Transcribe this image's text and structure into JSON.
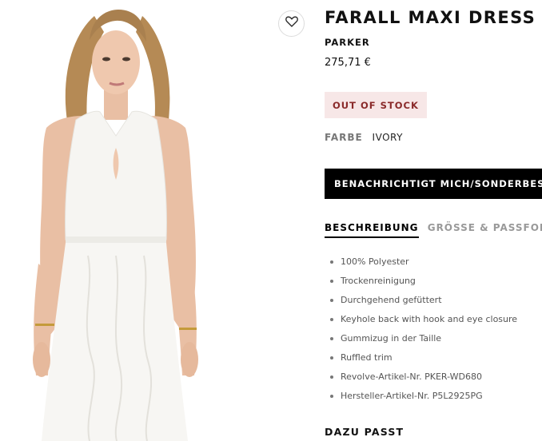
{
  "product": {
    "title": "FARALL MAXI DRESS",
    "brand": "PARKER",
    "price": "275,71 €",
    "stock_status": "OUT OF STOCK",
    "color_label": "FARBE",
    "color_value": "IVORY",
    "notify_button_label": "BENACHRICHTIGT MICH/SONDERBESTELLUNG"
  },
  "tabs": [
    {
      "label": "BESCHREIBUNG",
      "active": true
    },
    {
      "label": "GRÖSSE & PASSFORM",
      "active": false
    }
  ],
  "features": [
    "100% Polyester",
    "Trockenreinigung",
    "Durchgehend gefüttert",
    "Keyhole back with hook and eye closure",
    "Gummizug in der Taille",
    "Ruffled trim",
    "Revolve-Artikel-Nr. PKER-WD680",
    "Hersteller-Artikel-Nr. P5L2925PG"
  ],
  "related_heading": "DAZU PASST",
  "icons": {
    "wishlist": "heart-icon"
  },
  "colors": {
    "stock_bg": "#f7e7e7",
    "stock_text": "#8a2a2a",
    "button_bg": "#000000"
  }
}
